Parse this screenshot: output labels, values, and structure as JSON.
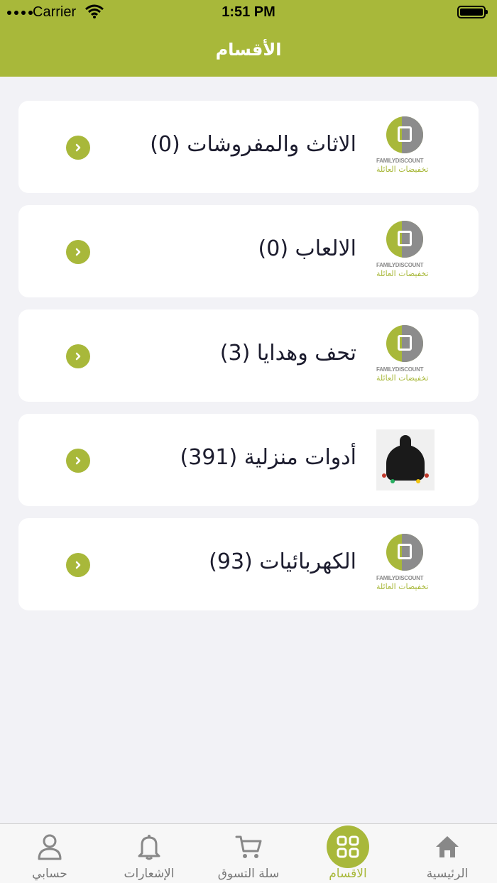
{
  "status": {
    "carrier": "Carrier",
    "time": "1:51 PM"
  },
  "header": {
    "title": "الأقسام"
  },
  "categories": [
    {
      "title": "الاثاث والمفروشات (0)",
      "thumb": "family-discount-logo"
    },
    {
      "title": "الالعاب (0)",
      "thumb": "family-discount-logo"
    },
    {
      "title": "تحف وهدايا (3)",
      "thumb": "family-discount-logo"
    },
    {
      "title": "أدوات منزلية (391)",
      "thumb": "lantern-product-photo"
    },
    {
      "title": "الكهربائيات (93)",
      "thumb": "family-discount-logo"
    }
  ],
  "logo": {
    "text_en": "FAMILYDISCOUNT",
    "text_ar": "تخفيضات العائلة"
  },
  "tabs": [
    {
      "label": "الرئيسية",
      "icon": "home-icon"
    },
    {
      "label": "الاقسام",
      "icon": "grid-icon",
      "active": true
    },
    {
      "label": "سلة التسوق",
      "icon": "cart-icon"
    },
    {
      "label": "الإشعارات",
      "icon": "bell-icon"
    },
    {
      "label": "حسابي",
      "icon": "user-icon"
    }
  ],
  "colors": {
    "accent": "#a8b83a",
    "background": "#f2f2f6",
    "card": "#ffffff"
  }
}
